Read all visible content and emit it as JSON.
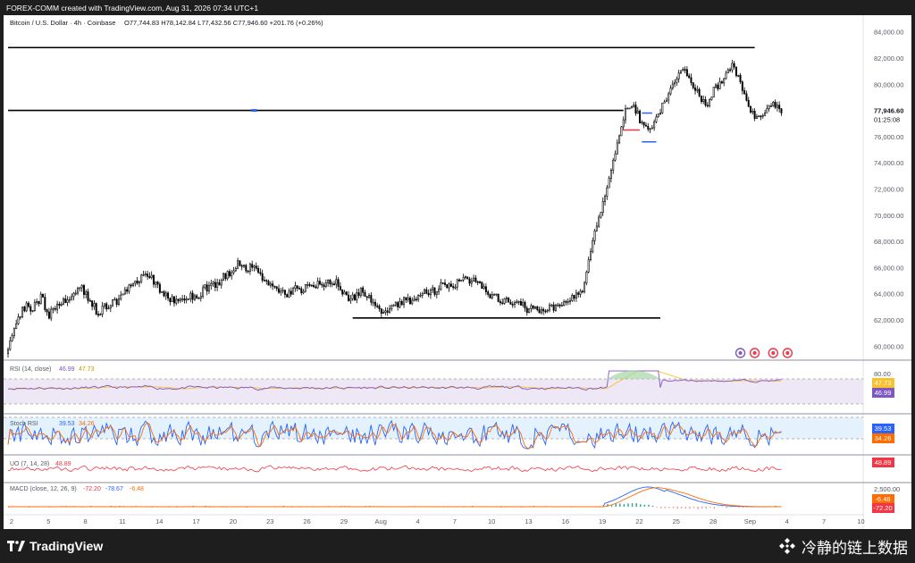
{
  "header": {
    "attribution": "FOREX-COMM created with TradingView.com, Aug 31, 2026 07:34 UTC+1"
  },
  "legend": {
    "symbol": "Bitcoin / U.S. Dollar · 4h · Coinbase",
    "ohlc_text": "O77,744.83  H78,142.84  L77,432.56  C77,946.60  +201.76 (+0.26%)",
    "open": 77744.83,
    "high": 78142.84,
    "low": 77432.56,
    "close": 77946.6,
    "change": 201.76,
    "change_pct": 0.26
  },
  "price_axis": {
    "ticks": [
      "84,000.00",
      "82,000.00",
      "80,000.00",
      "78,000.00",
      "76,000.00",
      "74,000.00",
      "72,000.00",
      "70,000.00",
      "68,000.00",
      "66,000.00",
      "64,000.00",
      "62,000.00",
      "60,000.00"
    ],
    "tick_values": [
      84000,
      82000,
      80000,
      78000,
      76000,
      74000,
      72000,
      70000,
      68000,
      66000,
      64000,
      62000,
      60000
    ],
    "last_price": "77,946.60",
    "countdown": "01:25:08"
  },
  "time_axis": {
    "ticks": [
      {
        "label": "2",
        "idx": 0
      },
      {
        "label": "5",
        "idx": 18
      },
      {
        "label": "8",
        "idx": 36
      },
      {
        "label": "11",
        "idx": 54
      },
      {
        "label": "14",
        "idx": 72
      },
      {
        "label": "17",
        "idx": 90
      },
      {
        "label": "20",
        "idx": 108
      },
      {
        "label": "23",
        "idx": 126
      },
      {
        "label": "26",
        "idx": 144
      },
      {
        "label": "29",
        "idx": 162
      },
      {
        "label": "Aug",
        "idx": 180
      },
      {
        "label": "4",
        "idx": 198
      },
      {
        "label": "7",
        "idx": 216
      },
      {
        "label": "10",
        "idx": 234
      },
      {
        "label": "13",
        "idx": 252
      },
      {
        "label": "16",
        "idx": 270
      },
      {
        "label": "19",
        "idx": 288
      },
      {
        "label": "22",
        "idx": 306
      },
      {
        "label": "25",
        "idx": 324
      },
      {
        "label": "28",
        "idx": 342
      },
      {
        "label": "Sep",
        "idx": 360
      },
      {
        "label": "4",
        "idx": 378
      },
      {
        "label": "7",
        "idx": 396
      },
      {
        "label": "10",
        "idx": 414
      }
    ]
  },
  "levels": [
    {
      "price": 82800,
      "from": 0,
      "to": 364
    },
    {
      "price": 78000,
      "from": 0,
      "to": 300
    },
    {
      "price": 62150,
      "from": 168,
      "to": 318
    }
  ],
  "panes": {
    "rsi": {
      "label": "RSI (14, close)",
      "v1": "46.99",
      "v2": "47.73",
      "top": "80.00",
      "c1": "#7e57c2",
      "c2": "#fbc02d"
    },
    "stoch": {
      "label": "Stoch RSI",
      "v1": "39.53",
      "v2": "34.26",
      "c1": "#2962ff",
      "c2": "#ff6d00"
    },
    "uo": {
      "label": "UO (7, 14, 28)",
      "v1": "48.89",
      "c1": "#f23645"
    },
    "macd": {
      "label": "MACD (close, 12, 26, 9)",
      "v1": "-72.20",
      "v2": "-78.67",
      "v3": "-6.48",
      "top": "2,500.00",
      "c1": "#2962ff",
      "c2": "#ff6d00",
      "c3": "#f23645"
    }
  },
  "chart_data": {
    "type": "line",
    "title": "Bitcoin / U.S. Dollar · 4h · Coinbase",
    "xlabel": "",
    "ylabel": "",
    "ylim": [
      59000,
      85000
    ],
    "x": [
      "2",
      "5",
      "8",
      "11",
      "14",
      "17",
      "20",
      "23",
      "26",
      "29",
      "Aug",
      "4",
      "7",
      "10",
      "13",
      "16",
      "19",
      "22",
      "25",
      "28",
      "Sep"
    ],
    "series": [
      {
        "values": [
          59800,
          61800,
          63000,
          62800,
          63800,
          62400,
          63200,
          63400,
          64000,
          64400,
          63600,
          62300,
          63200,
          63300,
          64300,
          64400,
          65300,
          65400,
          64700,
          64000,
          63500,
          63300,
          64000,
          63700,
          64400,
          64600,
          65100,
          65700,
          66400,
          66000,
          65800,
          65300,
          64600,
          64100,
          64000,
          64400,
          64300,
          64600,
          64700,
          65000,
          64800,
          63700,
          63800,
          64200,
          63800,
          62700,
          62600,
          63000,
          63400,
          63600,
          63800,
          64200,
          64300,
          64600,
          64800,
          64900,
          65000,
          64900,
          64300,
          63700,
          63600,
          63400,
          63300,
          62900,
          62700,
          62500,
          62900,
          63300,
          63600,
          64000,
          64500,
          68000,
          70200,
          72600,
          75300,
          77800,
          78400,
          77000,
          76500,
          77500,
          79000,
          80200,
          81000,
          80300,
          79100,
          78600,
          79700,
          80400,
          81400,
          80100,
          78200,
          77500,
          77600,
          78400,
          77900
        ]
      }
    ]
  }
}
